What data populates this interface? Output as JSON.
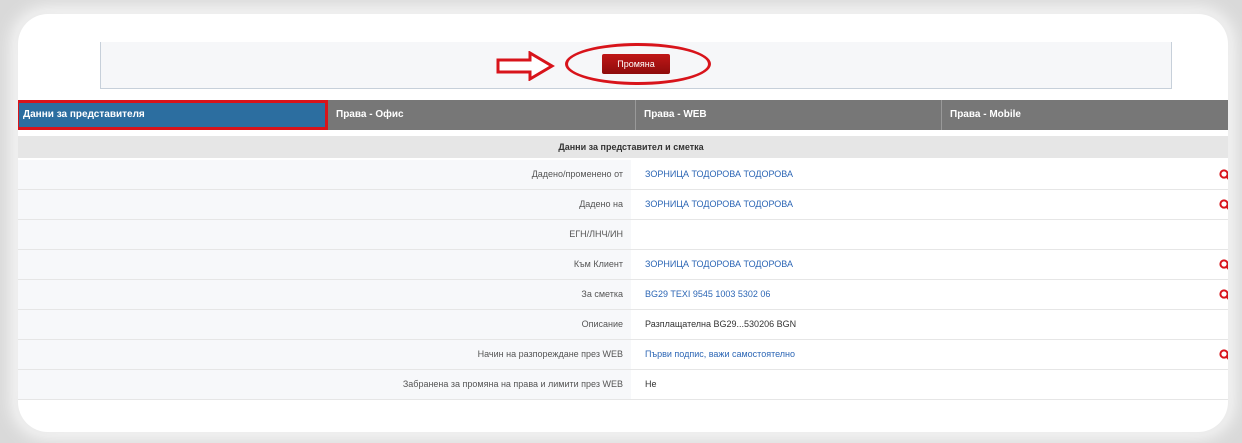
{
  "toolbar": {
    "change_label": "Промяна"
  },
  "tabs": [
    {
      "label": "Данни за представителя",
      "active": true
    },
    {
      "label": "Права - Офис",
      "active": false
    },
    {
      "label": "Права - WEB",
      "active": false
    },
    {
      "label": "Права - Mobile",
      "active": false
    }
  ],
  "section_title": "Данни за представител и сметка",
  "rows": [
    {
      "label": "Дадено/променено от",
      "value": "ЗОРНИЦА ТОДОРОВА ТОДОРОВА",
      "link": true,
      "lookup_icon": "search-icon"
    },
    {
      "label": "Дадено на",
      "value": "ЗОРНИЦА ТОДОРОВА ТОДОРОВА",
      "link": true,
      "lookup_icon": "search-icon"
    },
    {
      "label": "ЕГН/ЛНЧ/ИН",
      "value": "",
      "link": false,
      "lookup_icon": ""
    },
    {
      "label": "Към Клиент",
      "value": "ЗОРНИЦА ТОДОРОВА ТОДОРОВА",
      "link": true,
      "lookup_icon": "search-icon"
    },
    {
      "label": "За сметка",
      "value": "BG29 TEXI 9545 1003 5302 06",
      "link": true,
      "lookup_icon": "search-icon"
    },
    {
      "label": "Описание",
      "value": "Разплащателна BG29...530206 BGN",
      "link": false,
      "lookup_icon": ""
    },
    {
      "label": "Начин на разпореждане през WEB",
      "value": "Първи подпис, важи самостоятелно",
      "link": true,
      "lookup_icon": "search-icon"
    },
    {
      "label": "Забранена за промяна на права и лимити през WEB",
      "value": "Не",
      "link": false,
      "lookup_icon": ""
    }
  ],
  "colors": {
    "accent_red": "#d8141b",
    "active_tab": "#2c6ea0",
    "inactive_tab": "#777777",
    "link": "#2c66b5"
  }
}
